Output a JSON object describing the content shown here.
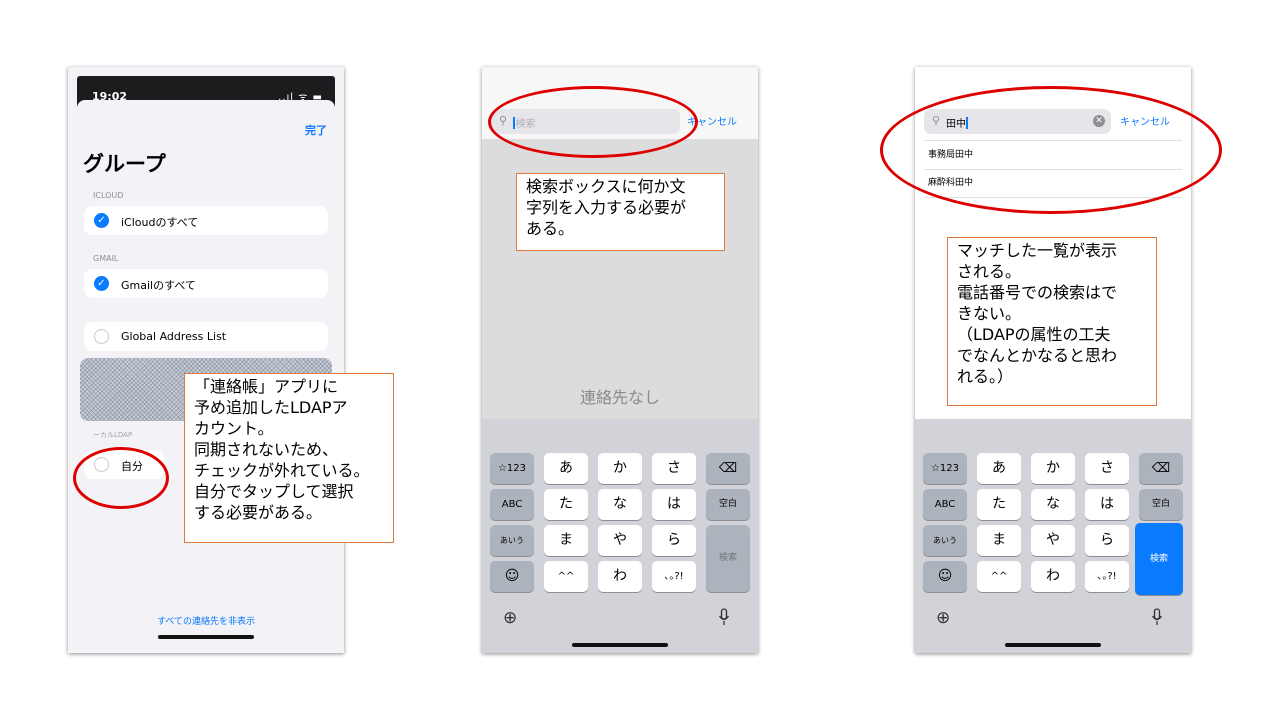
{
  "phone1": {
    "time": "19:02",
    "status_icons": "..ıl ᯤ ▬",
    "done": "完了",
    "title": "グループ",
    "sections": [
      {
        "label": "ICLOUD",
        "item": "iCloudのすべて",
        "checked": true
      },
      {
        "label": "GMAIL",
        "item": "Gmailのすべて",
        "checked": true
      }
    ],
    "global_item": "Global Address List",
    "local_label": "ーカルLDAP",
    "local_item": "自分",
    "hide_all": "すべての連絡先を非表示"
  },
  "phone2": {
    "search_placeholder": "検索",
    "cancel": "キャンセル",
    "empty_text": "連絡先なし"
  },
  "phone3": {
    "search_value": "田中",
    "cancel": "キャンセル",
    "results": [
      "事務局田中",
      "麻酔科田中"
    ]
  },
  "keyboard": {
    "row1": [
      "☆123",
      "あ",
      "か",
      "さ",
      "⌫"
    ],
    "row2": [
      "ABC",
      "た",
      "な",
      "は",
      "空白"
    ],
    "row3": [
      "あいう",
      "ま",
      "や",
      "ら"
    ],
    "row4": [
      "☺",
      "^^",
      "わ",
      "､｡?!"
    ],
    "enter": "検索"
  },
  "notes": {
    "note1": "「連絡帳」アプリに\n予め追加したLDAPア\nカウント。\n同期されないため、\nチェックが外れている。\n自分でタップして選択\nする必要がある。",
    "note2": "検索ボックスに何か文\n字列を入力する必要が\nある。",
    "note3": "マッチした一覧が表示\nされる。\n電話番号での検索はで\nきない。\n（LDAPの属性の工夫\nでなんとかなると思わ\nれる。）"
  },
  "colors": {
    "accent": "#0a7aff",
    "highlight": "#dd0000",
    "note_border": "#e07a3a"
  }
}
